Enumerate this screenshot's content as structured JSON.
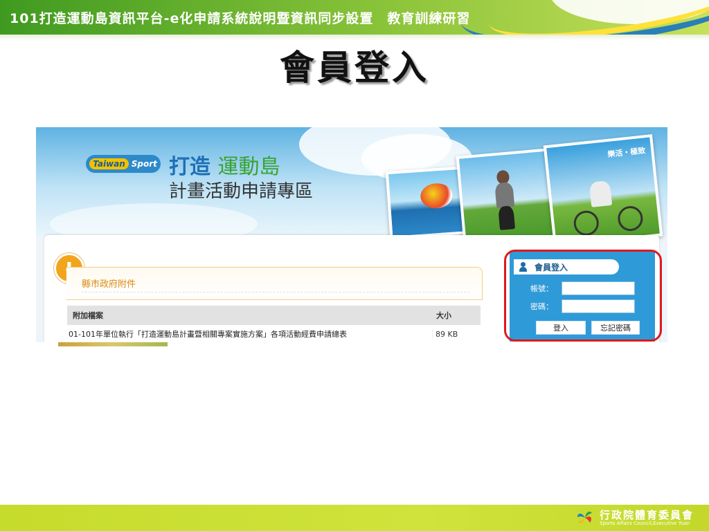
{
  "slide": {
    "top_title": "101打造運動島資訊平台-e化申請系統說明暨資訊同步設置　教育訓練研習",
    "heading": "會員登入",
    "org_name": "行政院體育委員會",
    "org_sub": "Sports Affairs Council,Executive Yuan"
  },
  "site": {
    "logo_text": "Sport",
    "logo_badge": "Taiwan",
    "title_line1_a": "打造",
    "title_line1_b": "運動島",
    "title_line2": "計畫活動申請專區",
    "photo_tag": "樂活・極致"
  },
  "attachments": {
    "section_title": "縣市政府附件",
    "columns": [
      "附加檔案",
      "大小"
    ],
    "rows": [
      {
        "name": "01-101年單位執行「打造運動島計畫暨相關專案實施方案」各項活動經費申請總表",
        "size": "89 KB"
      }
    ]
  },
  "login": {
    "title": "會員登入",
    "account_label": "帳號：",
    "password_label": "密碼：",
    "login_button": "登入",
    "forgot_button": "忘記密碼"
  },
  "colors": {
    "accent_green": "#8bc43a",
    "login_blue": "#2f9ad8",
    "highlight_red": "#e0181b",
    "footer_green": "#c6dc2c"
  }
}
